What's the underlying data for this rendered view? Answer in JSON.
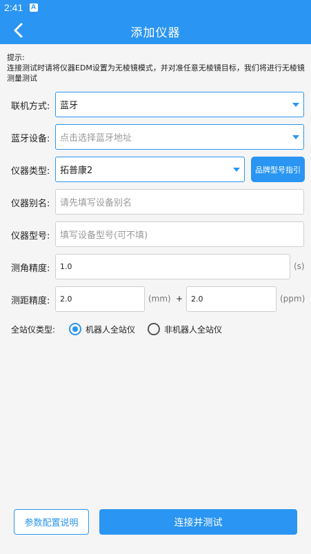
{
  "status_bar": {
    "time": "2:41",
    "sim_icon": "A"
  },
  "app_bar": {
    "back_icon": "chevron-left-icon",
    "title": "添加仪器"
  },
  "tip": {
    "heading": "提示:",
    "body": "连接测试时请将仪器EDM设置为无棱镜模式，并对准任意无棱镜目标，我们将进行无棱镜测量测试"
  },
  "form": {
    "connection": {
      "label": "联机方式:",
      "value": "蓝牙"
    },
    "bluetooth": {
      "label": "蓝牙设备:",
      "placeholder": "点击选择蓝牙地址"
    },
    "instrument_type": {
      "label": "仪器类型:",
      "value": "拓普康2",
      "guide_button": "品牌型号指引"
    },
    "alias": {
      "label": "仪器别名:",
      "placeholder": "请先填写设备别名"
    },
    "model": {
      "label": "仪器型号:",
      "placeholder": "填写设备型号(可不填)"
    },
    "angle_precision": {
      "label": "测角精度:",
      "value": "1.0",
      "unit": "(s)"
    },
    "distance_precision": {
      "label": "测距精度:",
      "value1": "2.0",
      "unit1": "(mm)",
      "plus": "+",
      "value2": "2.0",
      "unit2": "(ppm)"
    },
    "station_type": {
      "label": "全站仪类型:",
      "options": [
        {
          "label": "机器人全站仪",
          "selected": true
        },
        {
          "label": "非机器人全站仪",
          "selected": false
        }
      ]
    }
  },
  "buttons": {
    "config_help": "参数配置说明",
    "connect_test": "连接并测试"
  },
  "colors": {
    "primary": "#2a95f2",
    "background": "#f5f5f5"
  }
}
